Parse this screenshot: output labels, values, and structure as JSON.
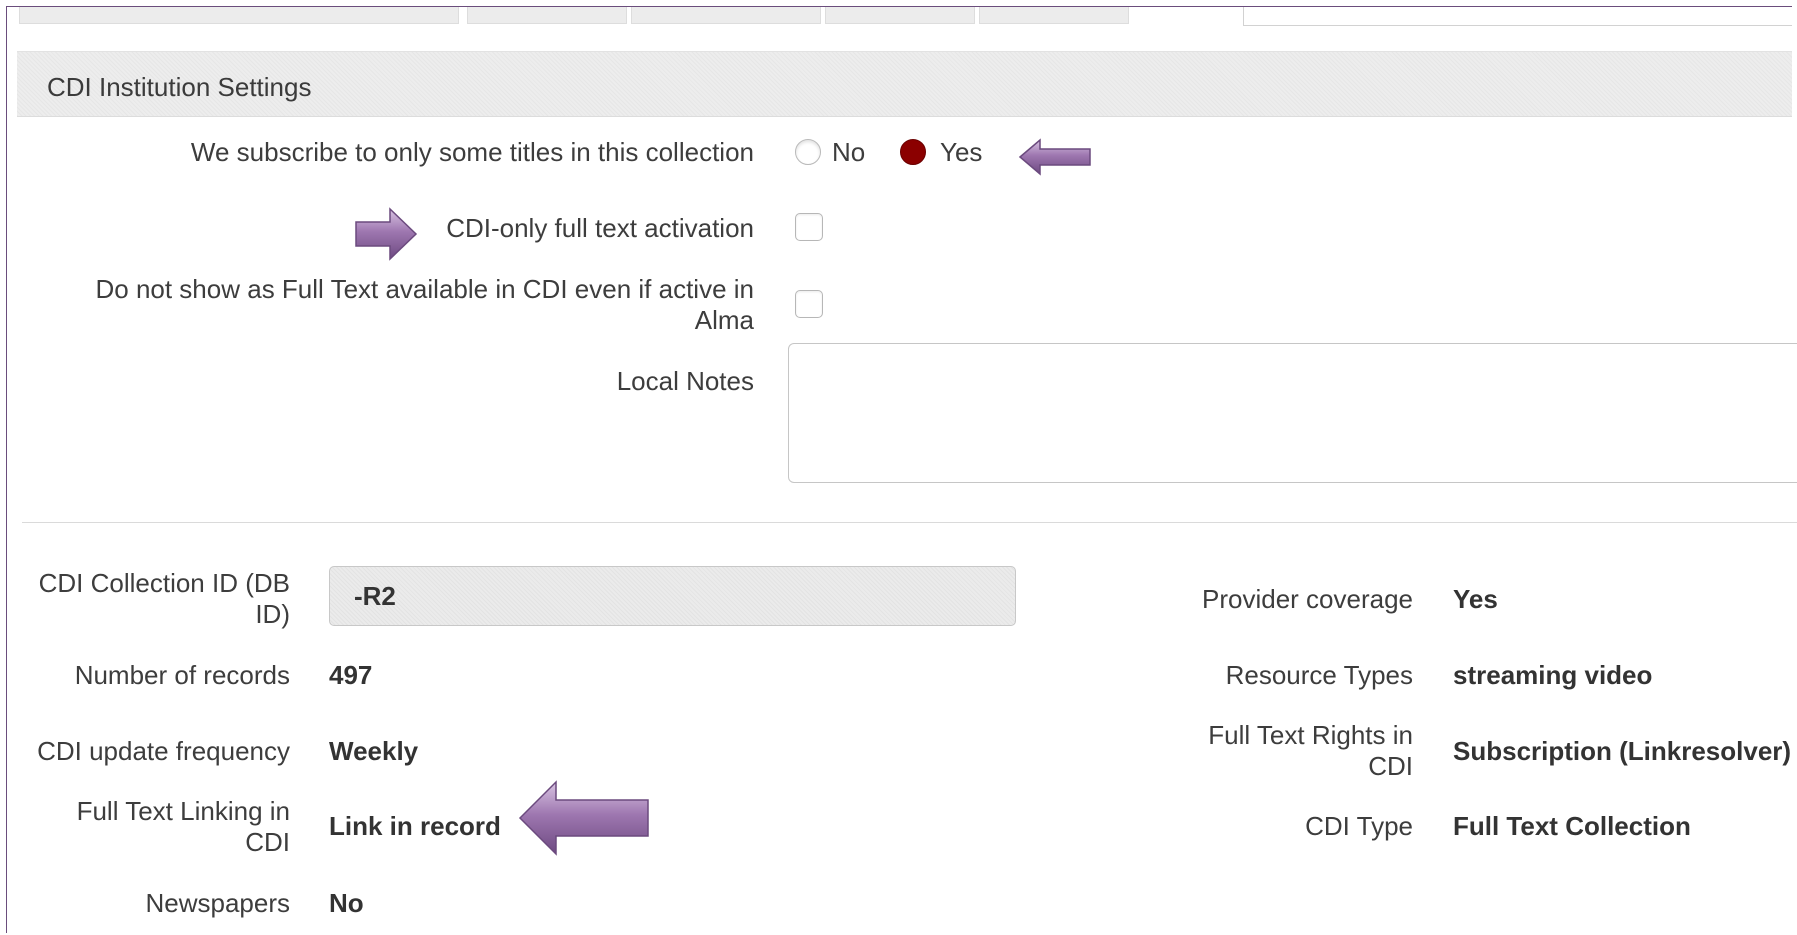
{
  "section": {
    "title": "CDI Institution Settings"
  },
  "settings": {
    "subscribe_some_titles": {
      "label": "We subscribe to only some titles in this collection",
      "options": [
        "No",
        "Yes"
      ],
      "selected": "Yes"
    },
    "cdi_only_full_text": {
      "label": "CDI-only full text activation",
      "checked": false
    },
    "do_not_show_full_text": {
      "label_line1": "Do not show as Full Text available in CDI even if active in",
      "label_line2": "Alma",
      "checked": false
    },
    "local_notes": {
      "label": "Local Notes",
      "value": ""
    }
  },
  "info": {
    "collection_id": {
      "label_line1": "CDI Collection ID (DB",
      "label_line2": "ID)",
      "value": "-R2"
    },
    "number_of_records": {
      "label": "Number of records",
      "value": "497"
    },
    "update_frequency": {
      "label": "CDI update frequency",
      "value": "Weekly"
    },
    "full_text_linking": {
      "label_line1": "Full Text Linking in",
      "label_line2": "CDI",
      "value": "Link in record"
    },
    "newspapers": {
      "label": "Newspapers",
      "value": "No"
    },
    "provider_coverage": {
      "label": "Provider coverage",
      "value": "Yes"
    },
    "resource_types": {
      "label": "Resource Types",
      "value": "streaming video"
    },
    "full_text_rights": {
      "label_line1": "Full Text Rights in",
      "label_line2": "CDI",
      "value": "Subscription (Linkresolver)"
    },
    "cdi_type": {
      "label": "CDI Type",
      "value": "Full Text Collection"
    }
  },
  "colors": {
    "radio_selected": "#8b0000",
    "arrow": "#8e6a9f",
    "frame": "#6a4d7c"
  },
  "icons": {
    "callout_arrow": "arrow-icon"
  }
}
